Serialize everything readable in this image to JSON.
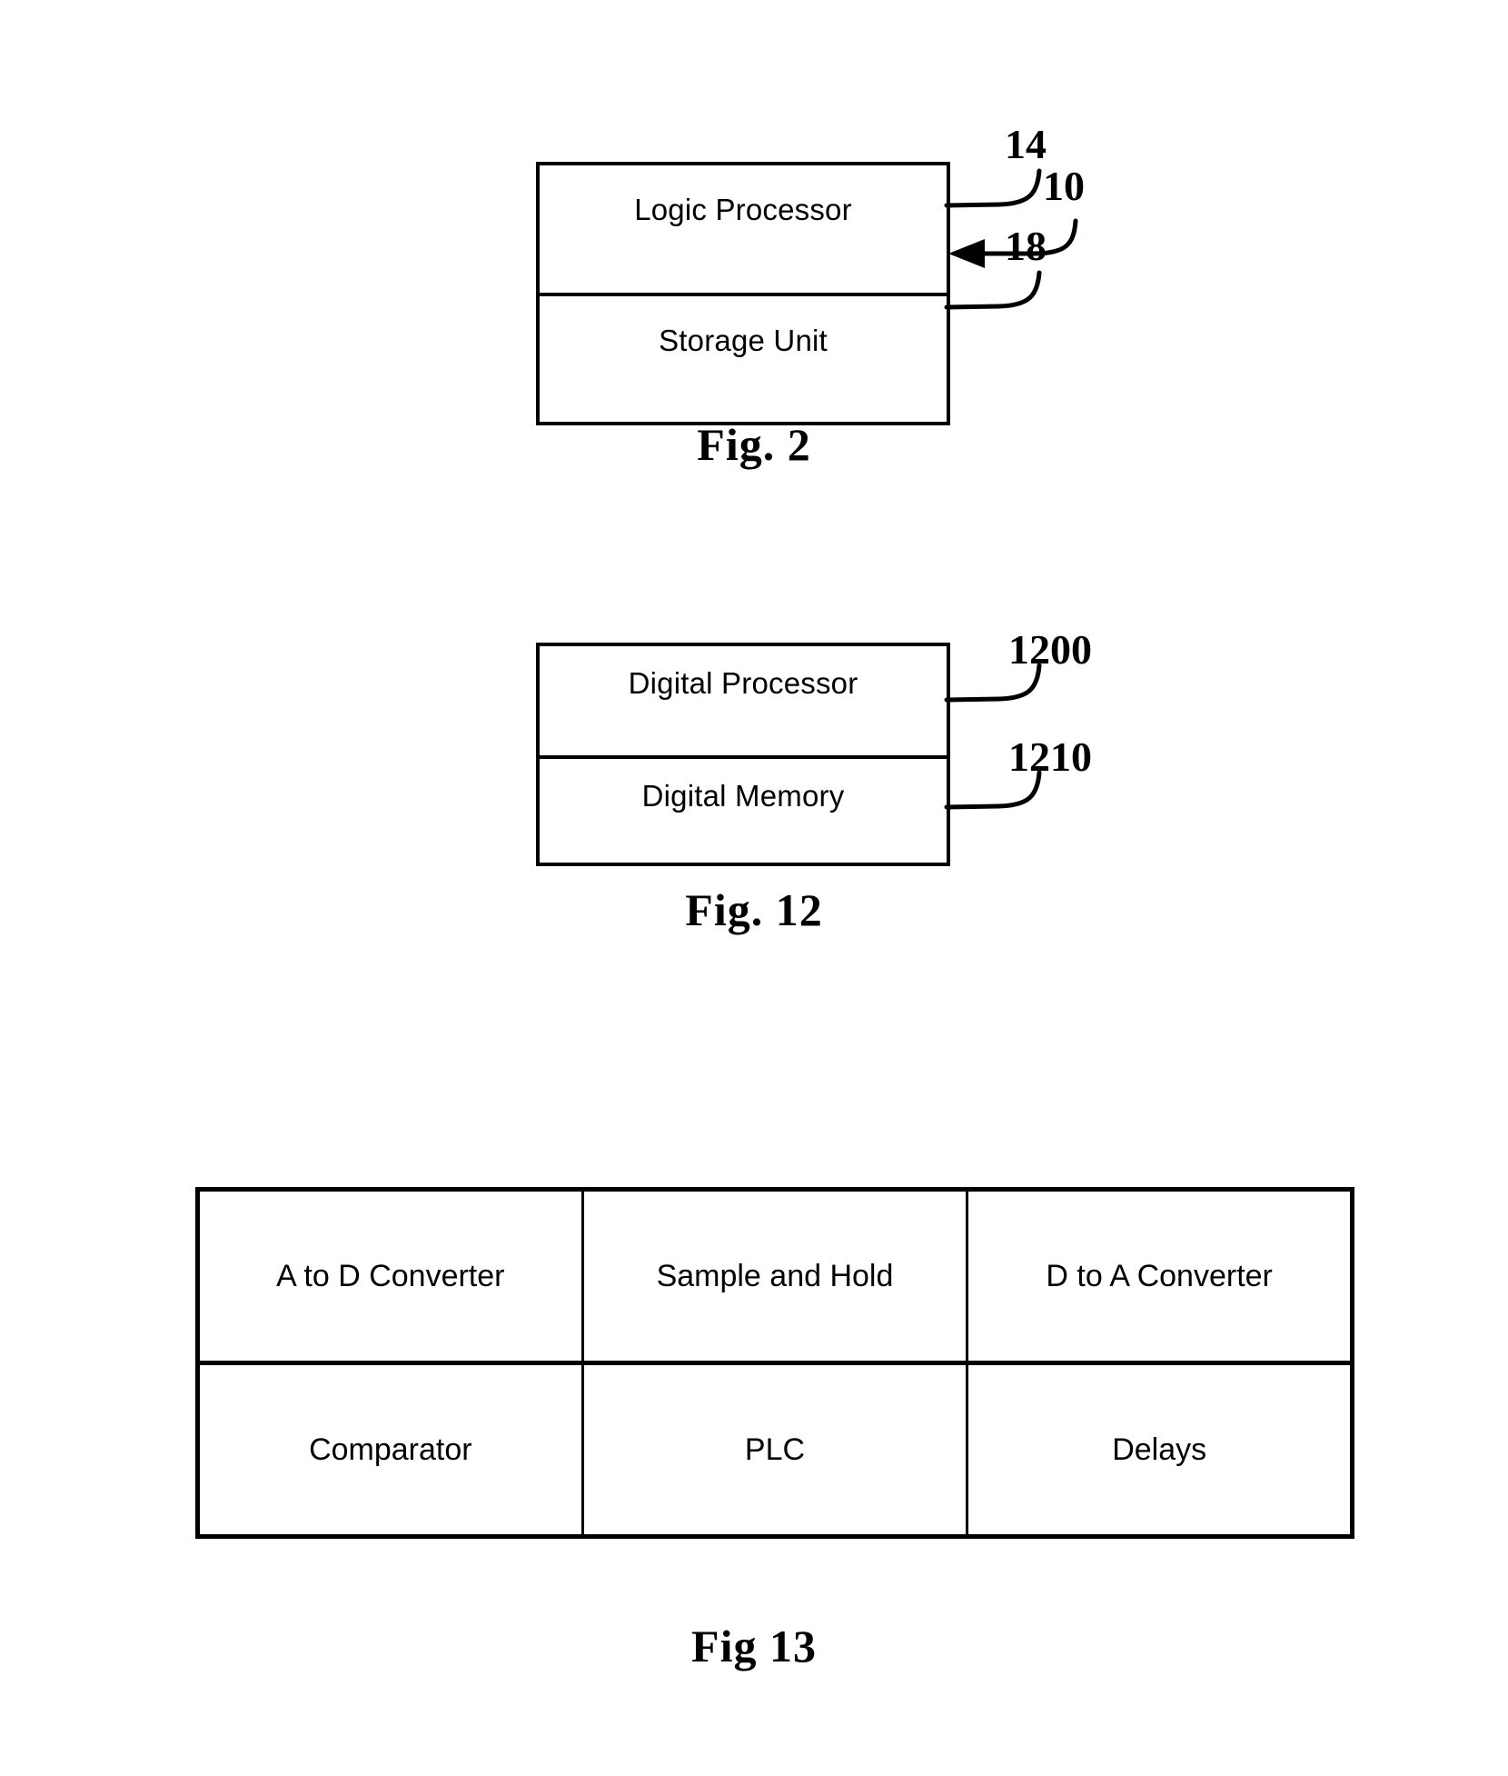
{
  "sheet": {
    "background_color": "#ffffff",
    "ink_color": "#000000"
  },
  "figures": [
    {
      "id": "fig-2",
      "caption": "Fig. 2",
      "blocks": [
        {
          "label": "Logic Processor"
        },
        {
          "label": "Storage Unit"
        }
      ],
      "callouts": [
        {
          "number": "14",
          "target": "Logic Processor",
          "style": "curve"
        },
        {
          "number": "10",
          "target": "assembly",
          "style": "arrow"
        },
        {
          "number": "18",
          "target": "Storage Unit",
          "style": "curve"
        }
      ]
    },
    {
      "id": "fig-12",
      "caption": "Fig. 12",
      "blocks": [
        {
          "label": "Digital Processor"
        },
        {
          "label": "Digital Memory"
        }
      ],
      "callouts": [
        {
          "number": "1200",
          "target": "Digital Processor",
          "style": "curve"
        },
        {
          "number": "1210",
          "target": "Digital Memory",
          "style": "curve"
        }
      ]
    },
    {
      "id": "fig-13",
      "caption": "Fig 13",
      "table": {
        "rows": [
          [
            "A to D Converter",
            "Sample and Hold",
            "D to A Converter"
          ],
          [
            "Comparator",
            "PLC",
            "Delays"
          ]
        ]
      }
    }
  ]
}
